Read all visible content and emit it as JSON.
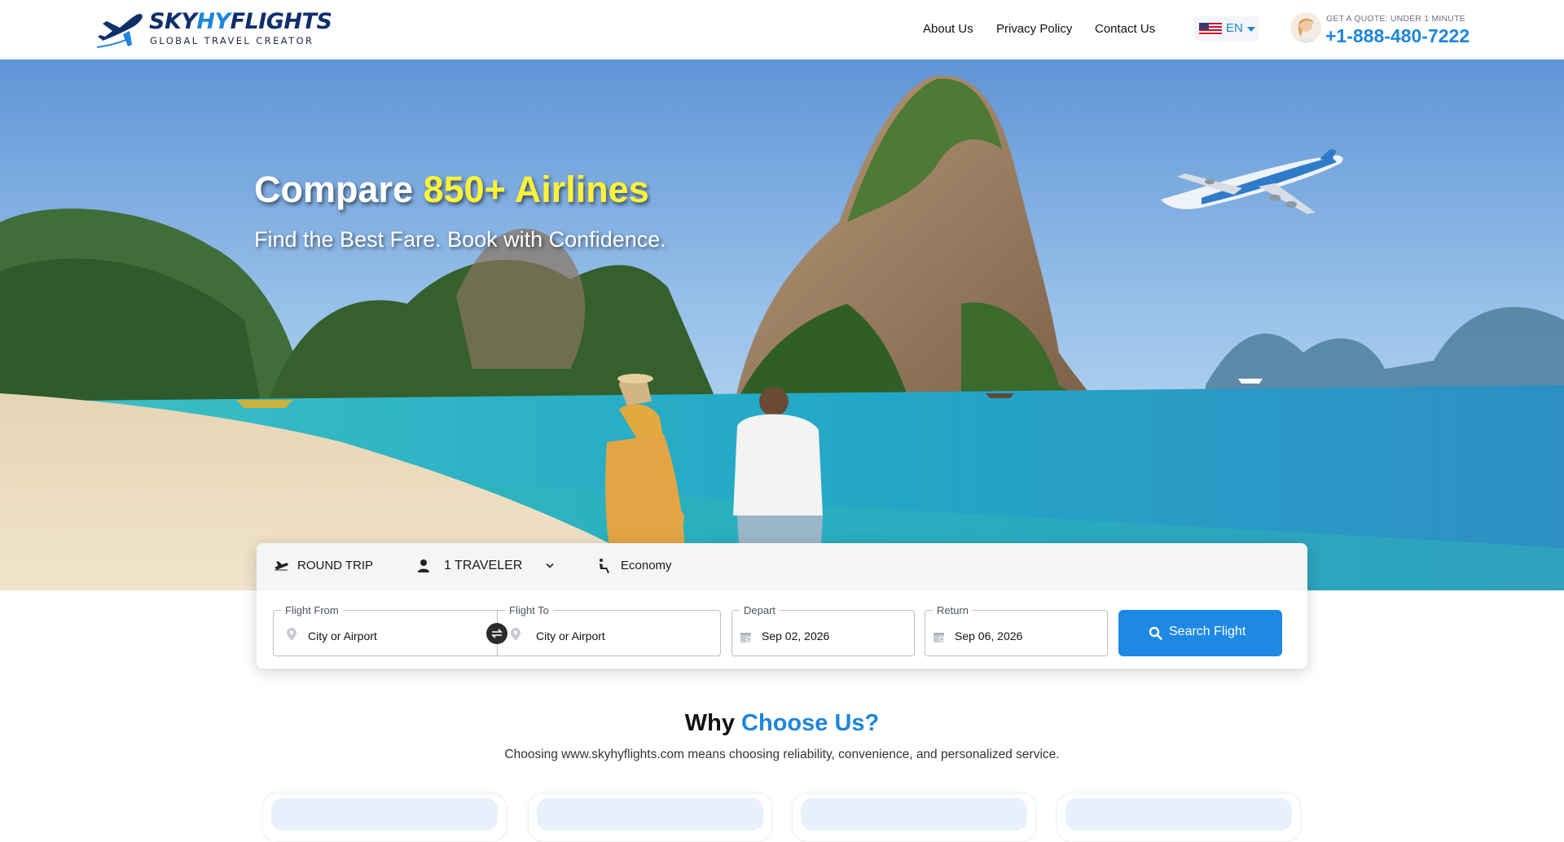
{
  "brand": {
    "name_part1": "SKY",
    "name_part2": "HY",
    "name_part3": "FLIGHTS",
    "tagline": "GLOBAL TRAVEL CREATOR"
  },
  "nav": {
    "items": [
      {
        "label": "About Us"
      },
      {
        "label": "Privacy Policy"
      },
      {
        "label": "Contact Us"
      }
    ],
    "language": "EN"
  },
  "quote": {
    "label": "GET A QUOTE: UNDER 1 MINUTE",
    "phone": "+1-888-480-7222"
  },
  "hero": {
    "title_prefix": "Compare ",
    "title_accent": "850+ Airlines",
    "subtitle": "Find the Best Fare. Book with Confidence."
  },
  "search": {
    "trip_type": "ROUND TRIP",
    "travelers": "1 TRAVELER",
    "cabin": "Economy",
    "from": {
      "legend": "Flight From",
      "value": "City or Airport"
    },
    "to": {
      "legend": "Flight To",
      "value": "City or Airport"
    },
    "depart": {
      "legend": "Depart",
      "value": "Sep 02, 2026"
    },
    "return": {
      "legend": "Return",
      "value": "Sep 06, 2026"
    },
    "button": "Search Flight"
  },
  "why": {
    "title_prefix": "Why ",
    "title_accent": "Choose Us?",
    "description": "Choosing www.skyhyflights.com means choosing reliability, convenience, and personalized service."
  },
  "colors": {
    "brand_blue": "#1f86d9",
    "navy": "#0f2f6b",
    "accent_yellow": "#fff23a",
    "button_blue": "#1e88e5"
  }
}
